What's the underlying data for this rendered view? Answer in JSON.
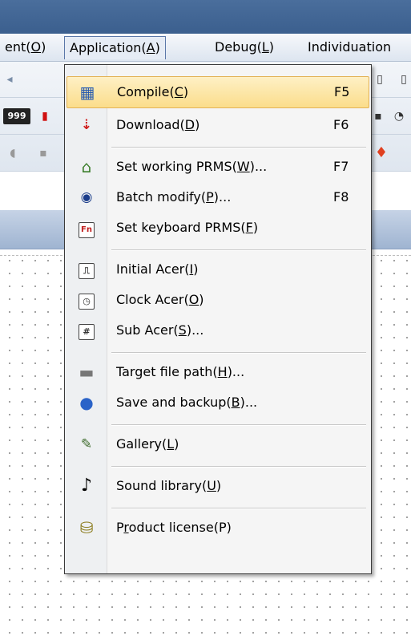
{
  "menubar": {
    "items": [
      {
        "text": "ent(",
        "key": "O",
        "tail": ")"
      },
      {
        "text": "Application(",
        "key": "A",
        "tail": ")"
      },
      {
        "text": "Debug(",
        "key": "L",
        "tail": ")"
      },
      {
        "text": "Individuation",
        "key": "",
        "tail": ""
      }
    ]
  },
  "toolbar": {
    "counter_text": "999"
  },
  "menu": {
    "items": [
      {
        "pre": "Compile(",
        "key": "C",
        "post": ")",
        "shortcut": "F5",
        "icon": "compile-icon",
        "glyph": "▦"
      },
      {
        "pre": "Download(",
        "key": "D",
        "post": ")",
        "shortcut": "F6",
        "icon": "download-icon",
        "glyph": "⇣"
      },
      {
        "pre": "Set working PRMS(",
        "key": "W",
        "post": ")...",
        "shortcut": "F7",
        "icon": "home-icon",
        "glyph": "⌂"
      },
      {
        "pre": "Batch modify(",
        "key": "P",
        "post": ")...",
        "shortcut": "F8",
        "icon": "batch-icon",
        "glyph": "◉"
      },
      {
        "pre": "Set keyboard PRMS(",
        "key": "F",
        "post": ")",
        "shortcut": "",
        "icon": "fn-key-icon",
        "glyph": "Fn"
      },
      {
        "pre": "Initial Acer(",
        "key": "I",
        "post": ")",
        "shortcut": "",
        "icon": "initial-acer-icon",
        "glyph": "⎍"
      },
      {
        "pre": "Clock Acer(",
        "key": "O",
        "post": ")",
        "shortcut": "",
        "icon": "clock-acer-icon",
        "glyph": "◷"
      },
      {
        "pre": "Sub Acer(",
        "key": "S",
        "post": ")...",
        "shortcut": "",
        "icon": "sub-acer-icon",
        "glyph": "#"
      },
      {
        "pre": "Target file path(",
        "key": "H",
        "post": ")...",
        "shortcut": "",
        "icon": "drive-icon",
        "glyph": "▬"
      },
      {
        "pre": "Save and backup(",
        "key": "B",
        "post": ")...",
        "shortcut": "",
        "icon": "backup-icon",
        "glyph": "●"
      },
      {
        "pre": "Gallery(",
        "key": "L",
        "post": ")",
        "shortcut": "",
        "icon": "gallery-icon",
        "glyph": "✎"
      },
      {
        "pre": "Sound library(",
        "key": "U",
        "post": ")",
        "shortcut": "",
        "icon": "music-note-icon",
        "glyph": "♪"
      },
      {
        "pre": "P",
        "key": "r",
        "post": "oduct license(P)",
        "shortcut": "",
        "icon": "coins-icon",
        "glyph": "⛁"
      }
    ]
  },
  "colors": {
    "highlight": "#fbdd8b",
    "menu_border": "#3a3a3a",
    "titlebar": "#3b5f8e"
  }
}
